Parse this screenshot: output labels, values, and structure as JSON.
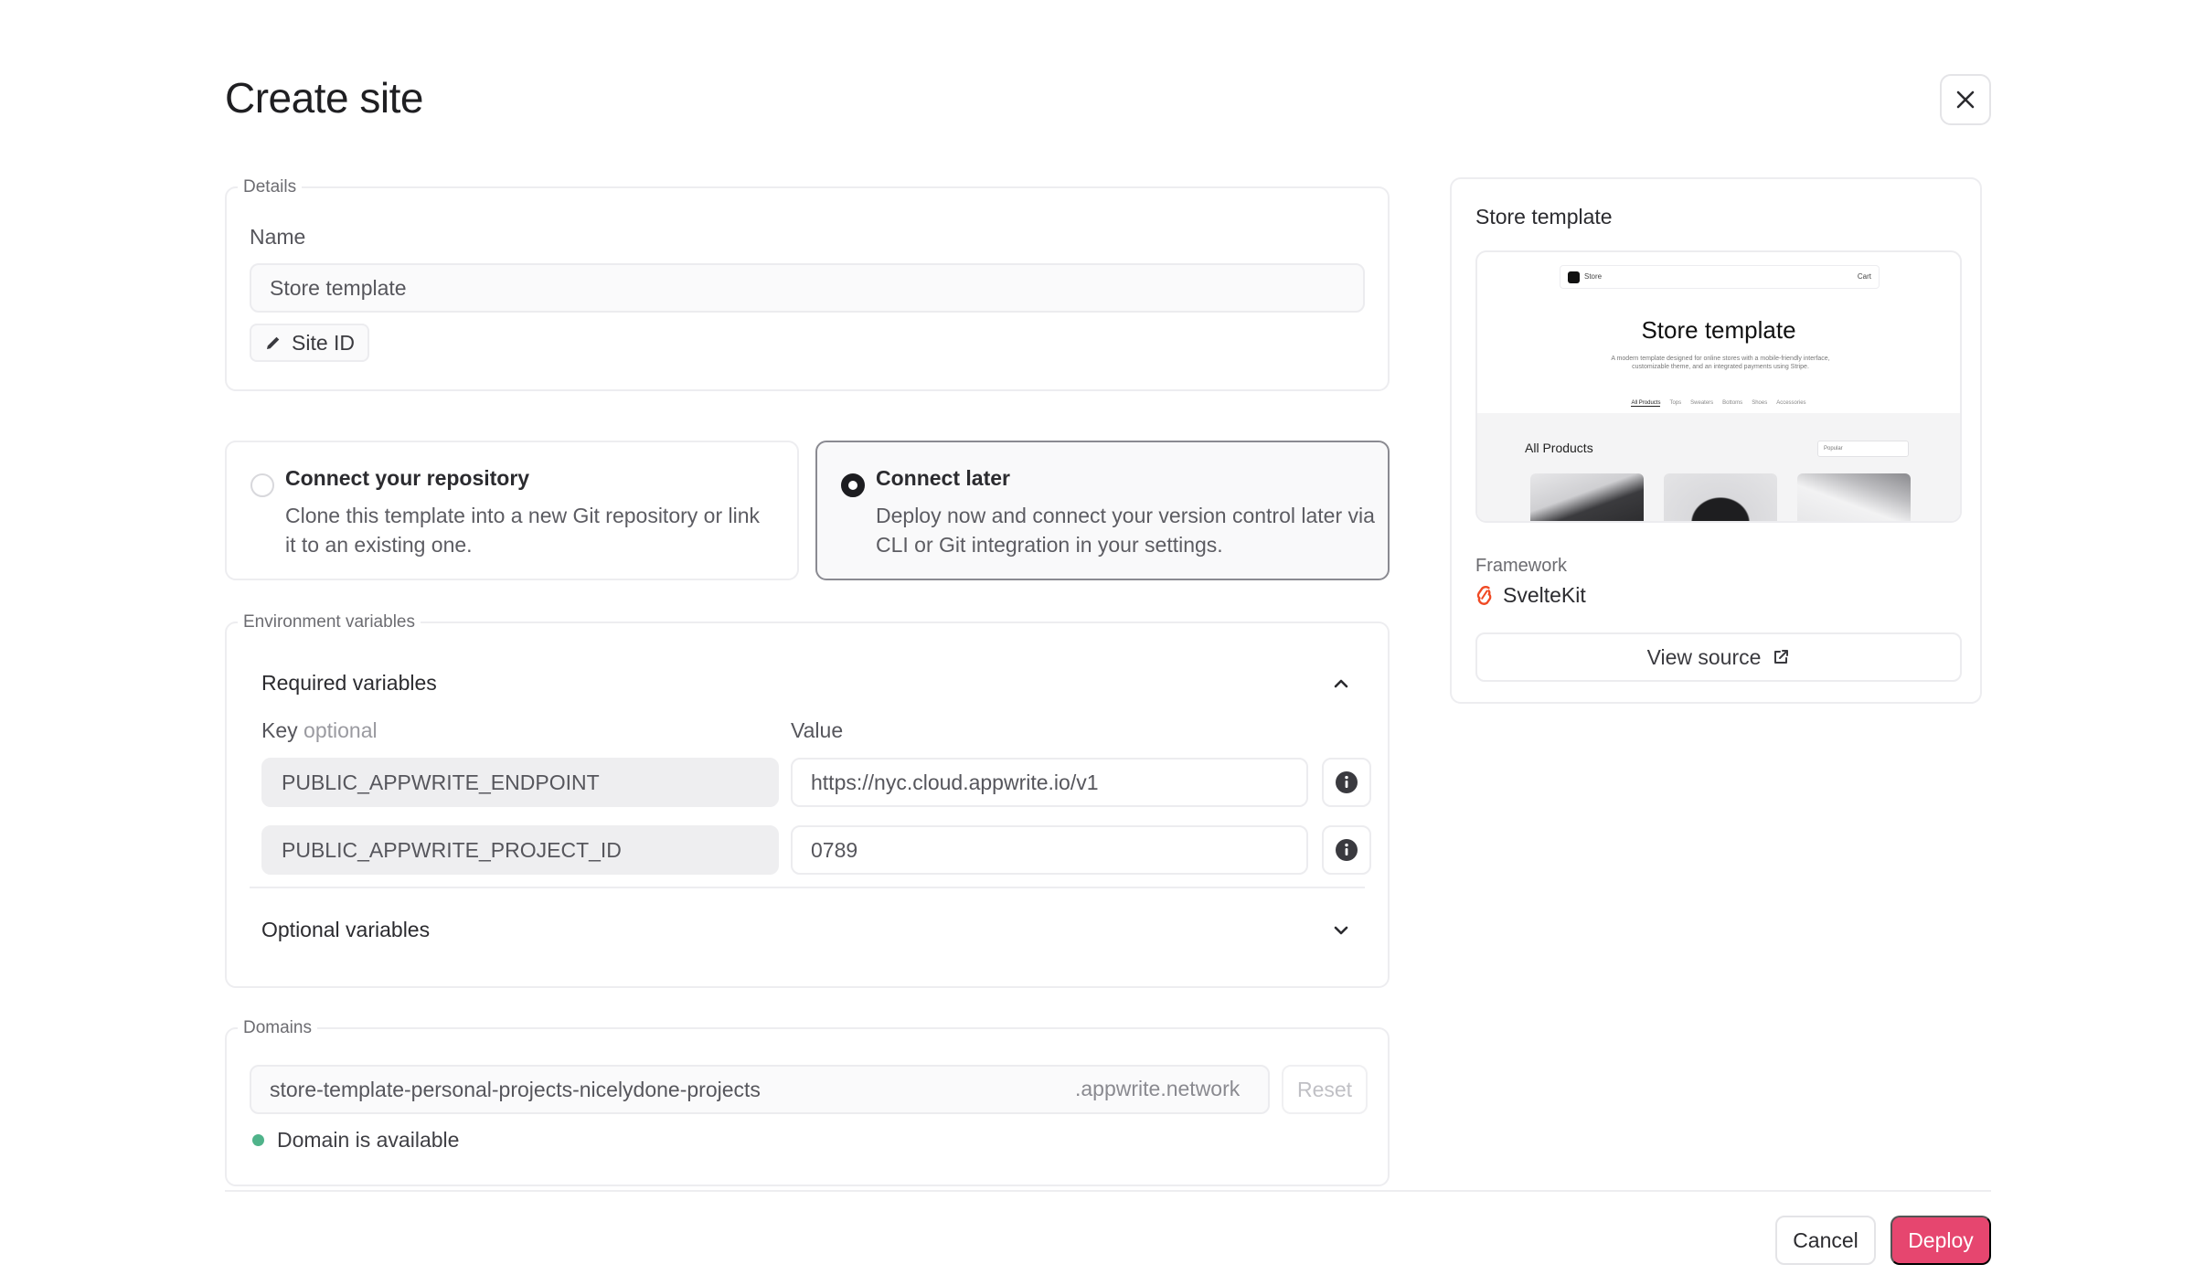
{
  "page": {
    "title": "Create site"
  },
  "details": {
    "legend": "Details",
    "name_label": "Name",
    "name_value": "Store template",
    "site_id_label": "Site ID"
  },
  "connect": {
    "repo": {
      "title": "Connect your repository",
      "desc": "Clone this template into a new Git repository or link it to an existing one.",
      "selected": false
    },
    "later": {
      "title": "Connect later",
      "desc": "Deploy now and connect your version control later via CLI or Git integration in your settings.",
      "selected": true
    }
  },
  "env": {
    "legend": "Environment variables",
    "required_title": "Required variables",
    "key_label": "Key",
    "key_hint": "optional",
    "value_label": "Value",
    "rows": [
      {
        "key": "PUBLIC_APPWRITE_ENDPOINT",
        "value": "https://nyc.cloud.appwrite.io/v1"
      },
      {
        "key": "PUBLIC_APPWRITE_PROJECT_ID",
        "value": "0789"
      }
    ],
    "optional_title": "Optional variables"
  },
  "domains": {
    "legend": "Domains",
    "domain_value": "store-template-personal-projects-nicelydone-projects",
    "suffix": ".appwrite.network",
    "reset_label": "Reset",
    "status_text": "Domain is available",
    "status_color": "#4fb38a"
  },
  "preview": {
    "title": "Store template",
    "thumb": {
      "nav_store": "Store",
      "nav_cart": "Cart",
      "hero_title": "Store template",
      "hero_desc": "A modern template designed for online stores with a mobile-friendly interface, customizable theme, and an integrated payments using Stripe.",
      "tabs": [
        "All Products",
        "Tops",
        "Sweaters",
        "Bottoms",
        "Shoes",
        "Accessories"
      ],
      "section": "All Products",
      "sort": "Popular"
    },
    "framework_label": "Framework",
    "framework_value": "SvelteKit",
    "framework_icon": "svelte-icon",
    "view_source_label": "View source"
  },
  "footer": {
    "cancel_label": "Cancel",
    "deploy_label": "Deploy",
    "deploy_color": "#e6466f"
  },
  "icons": {
    "close": "close-icon",
    "pencil": "pencil-icon",
    "info": "info-icon",
    "chevron_up": "chevron-up-icon",
    "chevron_down": "chevron-down-icon",
    "external": "external-link-icon"
  }
}
